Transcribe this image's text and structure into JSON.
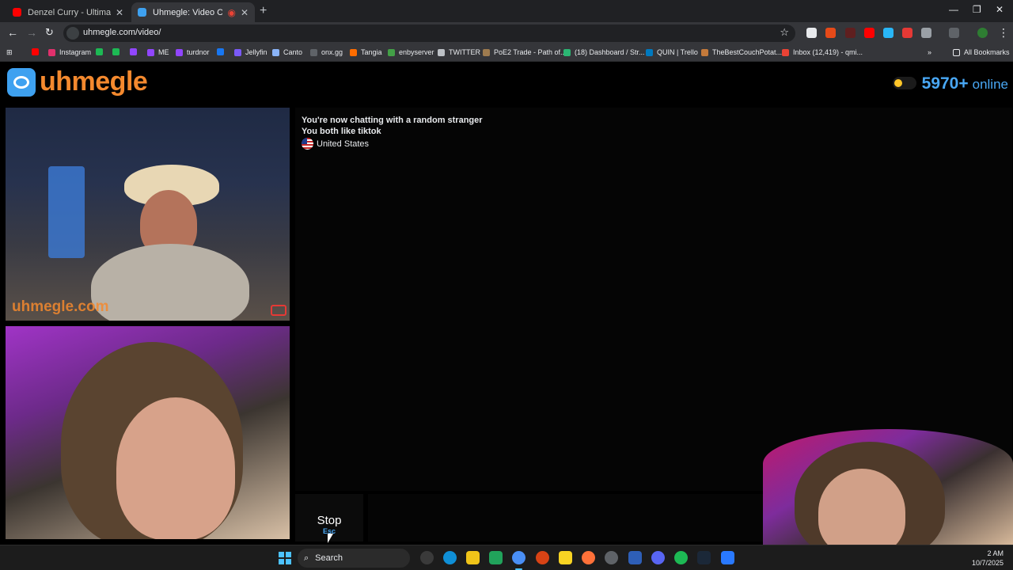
{
  "browser": {
    "tabs": [
      {
        "title": "Denzel Curry - Ultimate (BADB/",
        "icon": "youtube-icon",
        "color": "#ff0000"
      },
      {
        "title": "Uhmegle: Video Chat | Om",
        "icon": "uhmegle-icon",
        "color": "#3ea1f0"
      }
    ],
    "url": "uhmegle.com/video/",
    "bookmarks": [
      {
        "label": "",
        "color": "#ff0000"
      },
      {
        "label": "Instagram",
        "color": "#e1306c"
      },
      {
        "label": "",
        "color": "#1db954"
      },
      {
        "label": "",
        "color": "#1db954"
      },
      {
        "label": "",
        "color": "#9146ff"
      },
      {
        "label": "ME",
        "color": "#9146ff"
      },
      {
        "label": "turdnor",
        "color": "#9146ff"
      },
      {
        "label": "",
        "color": "#1877f2"
      },
      {
        "label": "Jellyfin",
        "color": "#7a5af8"
      },
      {
        "label": "Canto",
        "color": "#8ab4f8"
      },
      {
        "label": "onx.gg",
        "color": "#5f6368"
      },
      {
        "label": "Tangia",
        "color": "#ff6d00"
      },
      {
        "label": "enbyserver",
        "color": "#43a047"
      },
      {
        "label": "TWITTER",
        "color": "#bdc1c6"
      },
      {
        "label": "PoE2 Trade - Path of...",
        "color": "#9e7b4f"
      },
      {
        "label": "(18) Dashboard / Str...",
        "color": "#2bb673"
      },
      {
        "label": "QUIN | Trello",
        "color": "#0079bf"
      },
      {
        "label": "TheBestCouchPotat...",
        "color": "#c47a3b"
      },
      {
        "label": "Inbox (12,419) - qmi...",
        "color": "#ea4335"
      }
    ],
    "all_bookmarks": "All Bookmarks"
  },
  "site": {
    "logo": "uhmegle",
    "online_count": "5970+",
    "online_label": "online",
    "watermark": "uhmegle.com"
  },
  "chat": {
    "line1": "You're now chatting with a random stranger",
    "line2": "You both like tiktok",
    "country": "United States"
  },
  "controls": {
    "stop_label": "Stop",
    "stop_key": "Esc"
  },
  "taskbar": {
    "search_label": "Search",
    "time": "2 AM",
    "date": "10/7/2025"
  },
  "colors": {
    "accent_orange": "#f4892e",
    "accent_blue": "#49a8f5"
  }
}
